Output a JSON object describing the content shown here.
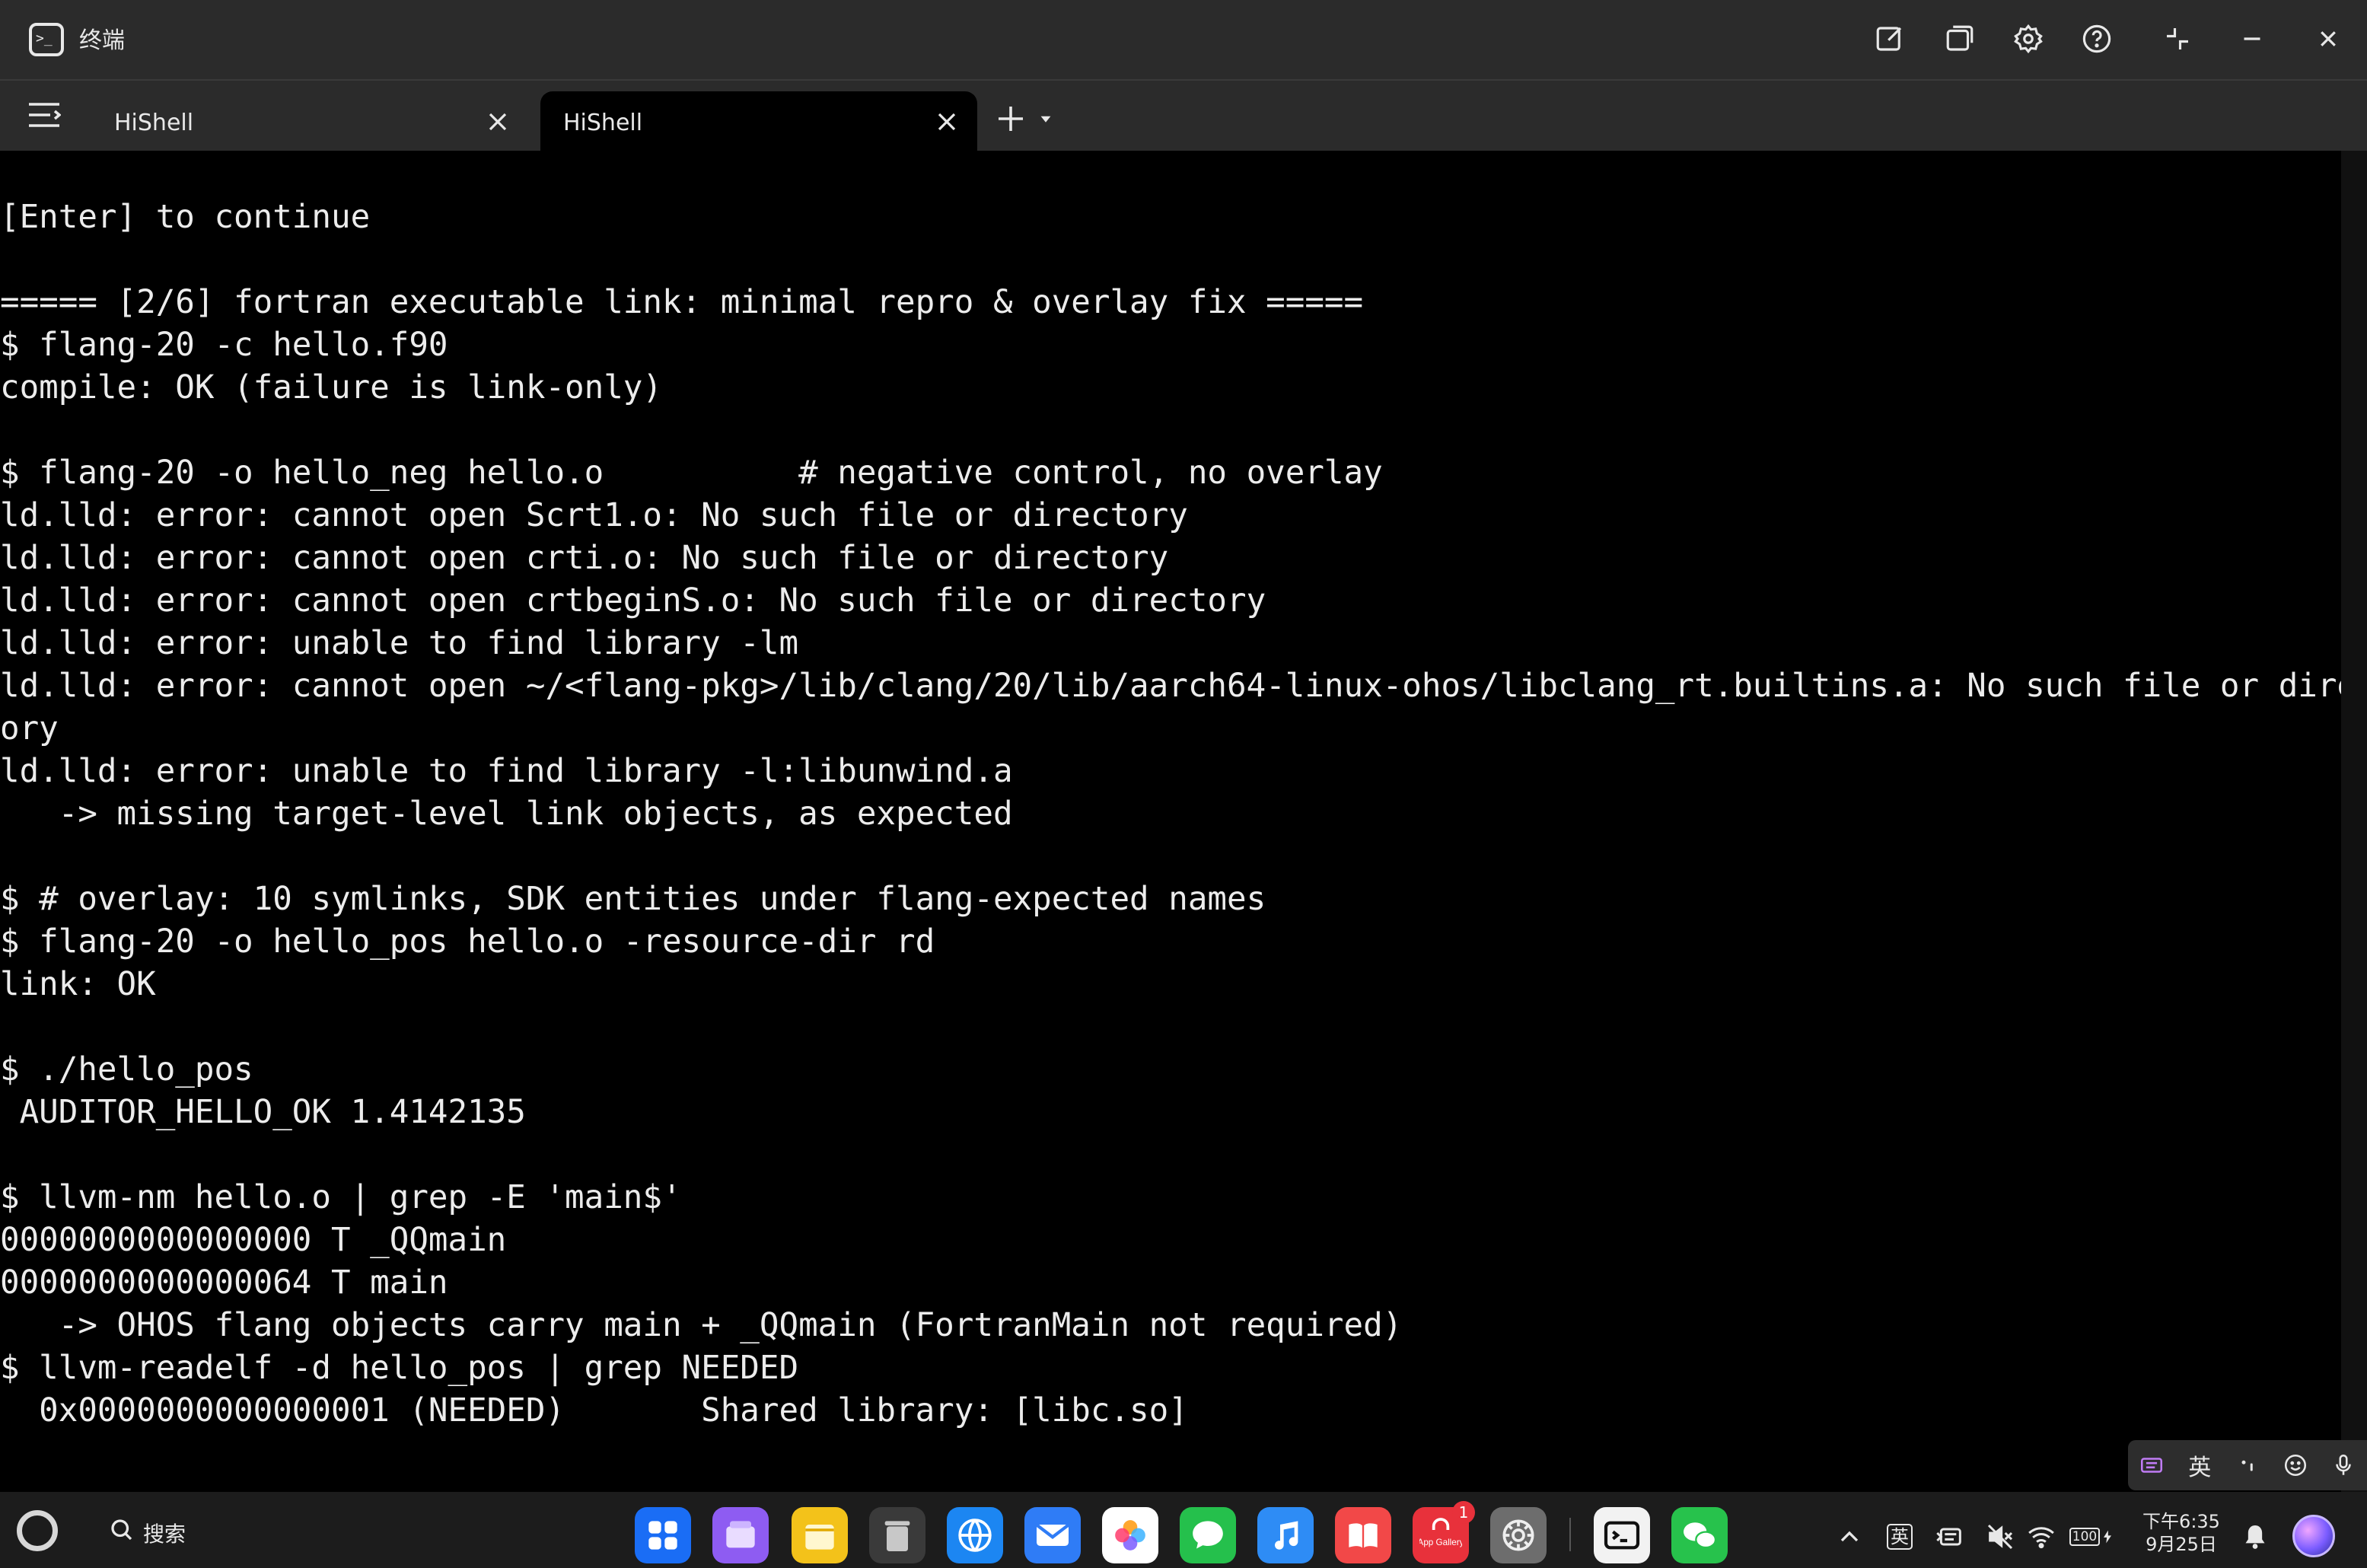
{
  "window": {
    "title": "终端"
  },
  "tabs": [
    {
      "label": "HiShell",
      "active": false
    },
    {
      "label": "HiShell",
      "active": true
    }
  ],
  "terminal": {
    "lines": [
      "[Enter] to continue",
      "",
      "===== [2/6] fortran executable link: minimal repro & overlay fix =====",
      "$ flang-20 -c hello.f90",
      "compile: OK (failure is link-only)",
      "",
      "$ flang-20 -o hello_neg hello.o          # negative control, no overlay",
      "ld.lld: error: cannot open Scrt1.o: No such file or directory",
      "ld.lld: error: cannot open crti.o: No such file or directory",
      "ld.lld: error: cannot open crtbeginS.o: No such file or directory",
      "ld.lld: error: unable to find library -lm",
      "ld.lld: error: cannot open ~/<flang-pkg>/lib/clang/20/lib/aarch64-linux-ohos/libclang_rt.builtins.a: No such file or direct",
      "ory",
      "ld.lld: error: unable to find library -l:libunwind.a",
      "   -> missing target-level link objects, as expected",
      "",
      "$ # overlay: 10 symlinks, SDK entities under flang-expected names",
      "$ flang-20 -o hello_pos hello.o -resource-dir rd",
      "link: OK",
      "",
      "$ ./hello_pos",
      " AUDITOR_HELLO_OK 1.4142135",
      "",
      "$ llvm-nm hello.o | grep -E 'main$'",
      "0000000000000000 T _QQmain",
      "0000000000000064 T main",
      "   -> OHOS flang objects carry main + _QQmain (FortranMain not required)",
      "$ llvm-readelf -d hello_pos | grep NEEDED",
      "  0x0000000000000001 (NEEDED)       Shared library: [libc.so]"
    ]
  },
  "ime": {
    "lang_label": "英"
  },
  "taskbar": {
    "search_label": "搜索",
    "dock": [
      {
        "name": "app-center",
        "color": "#1a6df5"
      },
      {
        "name": "files",
        "color": "#8e5cf2"
      },
      {
        "name": "notes",
        "color": "#f3c21a"
      },
      {
        "name": "trash",
        "color": "#9a9a9a"
      },
      {
        "name": "browser",
        "color": "#1c86f2"
      },
      {
        "name": "mail",
        "color": "#2f7cf6"
      },
      {
        "name": "photos",
        "color": "#ffffff"
      },
      {
        "name": "messages",
        "color": "#25c04c"
      },
      {
        "name": "music",
        "color": "#2e8cf5"
      },
      {
        "name": "books",
        "color": "#f24848"
      },
      {
        "name": "app-gallery",
        "color": "#e8313b",
        "label": "App Gallery"
      },
      {
        "name": "settings",
        "color": "#6d6d6d"
      },
      {
        "name": "terminal",
        "color": "#f2f2f2"
      },
      {
        "name": "wechat",
        "color": "#27c24c"
      }
    ],
    "app_gallery_badge": "1",
    "tray": {
      "ime_label": "英",
      "battery": "100",
      "time": "下午6:35",
      "date": "9月25日"
    }
  }
}
